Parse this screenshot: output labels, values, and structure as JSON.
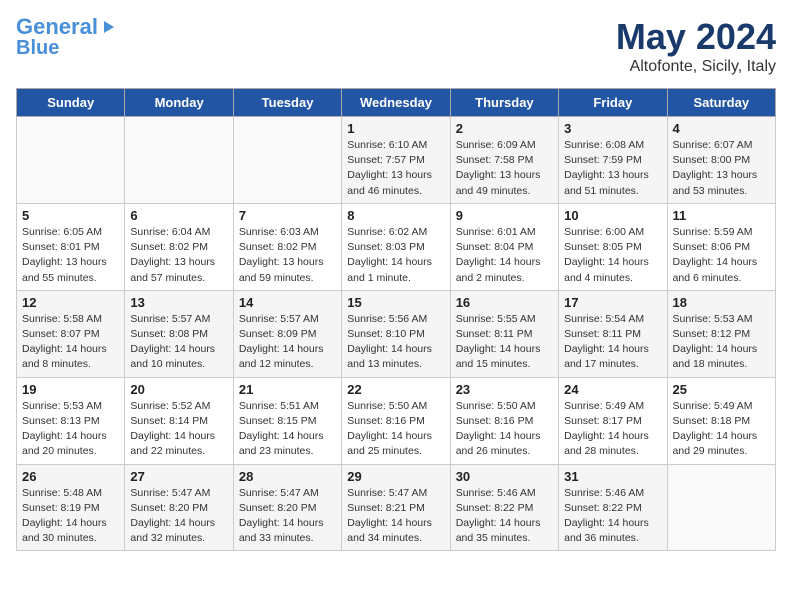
{
  "header": {
    "logo_line1": "General",
    "logo_line2": "Blue",
    "month": "May 2024",
    "location": "Altofonte, Sicily, Italy"
  },
  "weekdays": [
    "Sunday",
    "Monday",
    "Tuesday",
    "Wednesday",
    "Thursday",
    "Friday",
    "Saturday"
  ],
  "weeks": [
    [
      {
        "day": "",
        "sunrise": "",
        "sunset": "",
        "daylight": ""
      },
      {
        "day": "",
        "sunrise": "",
        "sunset": "",
        "daylight": ""
      },
      {
        "day": "",
        "sunrise": "",
        "sunset": "",
        "daylight": ""
      },
      {
        "day": "1",
        "sunrise": "Sunrise: 6:10 AM",
        "sunset": "Sunset: 7:57 PM",
        "daylight": "Daylight: 13 hours and 46 minutes."
      },
      {
        "day": "2",
        "sunrise": "Sunrise: 6:09 AM",
        "sunset": "Sunset: 7:58 PM",
        "daylight": "Daylight: 13 hours and 49 minutes."
      },
      {
        "day": "3",
        "sunrise": "Sunrise: 6:08 AM",
        "sunset": "Sunset: 7:59 PM",
        "daylight": "Daylight: 13 hours and 51 minutes."
      },
      {
        "day": "4",
        "sunrise": "Sunrise: 6:07 AM",
        "sunset": "Sunset: 8:00 PM",
        "daylight": "Daylight: 13 hours and 53 minutes."
      }
    ],
    [
      {
        "day": "5",
        "sunrise": "Sunrise: 6:05 AM",
        "sunset": "Sunset: 8:01 PM",
        "daylight": "Daylight: 13 hours and 55 minutes."
      },
      {
        "day": "6",
        "sunrise": "Sunrise: 6:04 AM",
        "sunset": "Sunset: 8:02 PM",
        "daylight": "Daylight: 13 hours and 57 minutes."
      },
      {
        "day": "7",
        "sunrise": "Sunrise: 6:03 AM",
        "sunset": "Sunset: 8:02 PM",
        "daylight": "Daylight: 13 hours and 59 minutes."
      },
      {
        "day": "8",
        "sunrise": "Sunrise: 6:02 AM",
        "sunset": "Sunset: 8:03 PM",
        "daylight": "Daylight: 14 hours and 1 minute."
      },
      {
        "day": "9",
        "sunrise": "Sunrise: 6:01 AM",
        "sunset": "Sunset: 8:04 PM",
        "daylight": "Daylight: 14 hours and 2 minutes."
      },
      {
        "day": "10",
        "sunrise": "Sunrise: 6:00 AM",
        "sunset": "Sunset: 8:05 PM",
        "daylight": "Daylight: 14 hours and 4 minutes."
      },
      {
        "day": "11",
        "sunrise": "Sunrise: 5:59 AM",
        "sunset": "Sunset: 8:06 PM",
        "daylight": "Daylight: 14 hours and 6 minutes."
      }
    ],
    [
      {
        "day": "12",
        "sunrise": "Sunrise: 5:58 AM",
        "sunset": "Sunset: 8:07 PM",
        "daylight": "Daylight: 14 hours and 8 minutes."
      },
      {
        "day": "13",
        "sunrise": "Sunrise: 5:57 AM",
        "sunset": "Sunset: 8:08 PM",
        "daylight": "Daylight: 14 hours and 10 minutes."
      },
      {
        "day": "14",
        "sunrise": "Sunrise: 5:57 AM",
        "sunset": "Sunset: 8:09 PM",
        "daylight": "Daylight: 14 hours and 12 minutes."
      },
      {
        "day": "15",
        "sunrise": "Sunrise: 5:56 AM",
        "sunset": "Sunset: 8:10 PM",
        "daylight": "Daylight: 14 hours and 13 minutes."
      },
      {
        "day": "16",
        "sunrise": "Sunrise: 5:55 AM",
        "sunset": "Sunset: 8:11 PM",
        "daylight": "Daylight: 14 hours and 15 minutes."
      },
      {
        "day": "17",
        "sunrise": "Sunrise: 5:54 AM",
        "sunset": "Sunset: 8:11 PM",
        "daylight": "Daylight: 14 hours and 17 minutes."
      },
      {
        "day": "18",
        "sunrise": "Sunrise: 5:53 AM",
        "sunset": "Sunset: 8:12 PM",
        "daylight": "Daylight: 14 hours and 18 minutes."
      }
    ],
    [
      {
        "day": "19",
        "sunrise": "Sunrise: 5:53 AM",
        "sunset": "Sunset: 8:13 PM",
        "daylight": "Daylight: 14 hours and 20 minutes."
      },
      {
        "day": "20",
        "sunrise": "Sunrise: 5:52 AM",
        "sunset": "Sunset: 8:14 PM",
        "daylight": "Daylight: 14 hours and 22 minutes."
      },
      {
        "day": "21",
        "sunrise": "Sunrise: 5:51 AM",
        "sunset": "Sunset: 8:15 PM",
        "daylight": "Daylight: 14 hours and 23 minutes."
      },
      {
        "day": "22",
        "sunrise": "Sunrise: 5:50 AM",
        "sunset": "Sunset: 8:16 PM",
        "daylight": "Daylight: 14 hours and 25 minutes."
      },
      {
        "day": "23",
        "sunrise": "Sunrise: 5:50 AM",
        "sunset": "Sunset: 8:16 PM",
        "daylight": "Daylight: 14 hours and 26 minutes."
      },
      {
        "day": "24",
        "sunrise": "Sunrise: 5:49 AM",
        "sunset": "Sunset: 8:17 PM",
        "daylight": "Daylight: 14 hours and 28 minutes."
      },
      {
        "day": "25",
        "sunrise": "Sunrise: 5:49 AM",
        "sunset": "Sunset: 8:18 PM",
        "daylight": "Daylight: 14 hours and 29 minutes."
      }
    ],
    [
      {
        "day": "26",
        "sunrise": "Sunrise: 5:48 AM",
        "sunset": "Sunset: 8:19 PM",
        "daylight": "Daylight: 14 hours and 30 minutes."
      },
      {
        "day": "27",
        "sunrise": "Sunrise: 5:47 AM",
        "sunset": "Sunset: 8:20 PM",
        "daylight": "Daylight: 14 hours and 32 minutes."
      },
      {
        "day": "28",
        "sunrise": "Sunrise: 5:47 AM",
        "sunset": "Sunset: 8:20 PM",
        "daylight": "Daylight: 14 hours and 33 minutes."
      },
      {
        "day": "29",
        "sunrise": "Sunrise: 5:47 AM",
        "sunset": "Sunset: 8:21 PM",
        "daylight": "Daylight: 14 hours and 34 minutes."
      },
      {
        "day": "30",
        "sunrise": "Sunrise: 5:46 AM",
        "sunset": "Sunset: 8:22 PM",
        "daylight": "Daylight: 14 hours and 35 minutes."
      },
      {
        "day": "31",
        "sunrise": "Sunrise: 5:46 AM",
        "sunset": "Sunset: 8:22 PM",
        "daylight": "Daylight: 14 hours and 36 minutes."
      },
      {
        "day": "",
        "sunrise": "",
        "sunset": "",
        "daylight": ""
      }
    ]
  ]
}
